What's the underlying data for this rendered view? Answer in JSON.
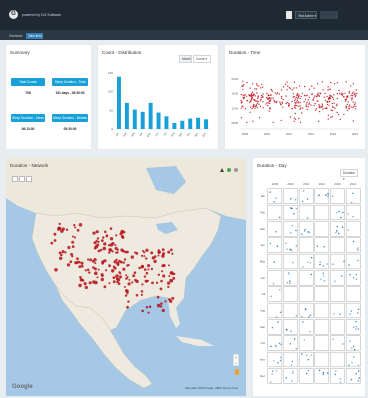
{
  "app": {
    "brand": "powered by DJI Software",
    "logo_letter": "G",
    "top_select": "Test Admin ▾"
  },
  "tabs": [
    {
      "label": "Overview",
      "active": false
    },
    {
      "label": "Tabs field",
      "active": true
    }
  ],
  "summary": {
    "title": "Summary",
    "items": [
      {
        "label": "Total Counts",
        "value": "708"
      },
      {
        "label": "Sleep Duration - Total",
        "value": "151 days - 09:30:00"
      },
      {
        "label": "Sleep Duration - Mean",
        "value": "06:13:00"
      },
      {
        "label": "Sleep Duration - Median",
        "value": "05:30:00"
      }
    ]
  },
  "count_panel": {
    "title": "Count - Distribution",
    "toggle_a": "Month",
    "toggle_b": "Count ▾",
    "chart_data": {
      "type": "bar",
      "categories": [
        "Jan",
        "Feb",
        "Mar",
        "Apr",
        "May",
        "Jun",
        "Jul",
        "Aug",
        "Sep",
        "Oct",
        "Nov",
        "Dec"
      ],
      "values": [
        140,
        70,
        52,
        46,
        70,
        44,
        34,
        16,
        22,
        28,
        30,
        26
      ],
      "ylim": [
        0,
        150
      ],
      "yticks": [
        "0",
        "50",
        "100",
        "150"
      ],
      "color": "#1aa0d8"
    }
  },
  "time_panel": {
    "title": "Duration - Time",
    "chart_data": {
      "type": "scatter",
      "xticks": [
        "2009",
        "2010",
        "2011",
        "2012",
        "2013",
        "2014"
      ],
      "yticks": [
        "20:00",
        "16:00",
        "12:00",
        "08:00"
      ],
      "color": "#c0141a"
    }
  },
  "map_panel": {
    "title": "Duration - Network",
    "google_label": "Google",
    "attribution": "Map data ©2015 Google, INEGI   Terms of Use",
    "marker_color": "#b5121b"
  },
  "day_panel": {
    "title": "Duration - Day",
    "select": "Duration ▾",
    "year_labels": [
      "2009",
      "2010",
      "2011",
      "2012",
      "2013",
      "2014"
    ],
    "month_labels": [
      "Jan",
      "Feb",
      "Mar",
      "Apr",
      "May",
      "Jun",
      "Jul",
      "Aug",
      "Sep",
      "Oct",
      "Nov",
      "Dec"
    ],
    "color": "#1a73b8"
  }
}
